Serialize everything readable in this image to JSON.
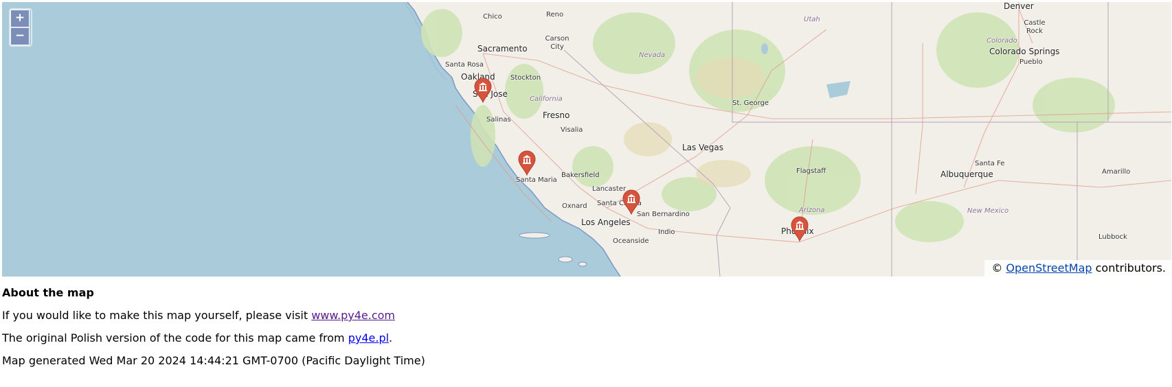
{
  "zoom": {
    "in_label": "+",
    "out_label": "−"
  },
  "attribution": {
    "prefix": "© ",
    "link": "OpenStreetMap",
    "suffix": " contributors."
  },
  "places": [
    {
      "name": "Chico",
      "kind": "city"
    },
    {
      "name": "Reno",
      "kind": "city"
    },
    {
      "name": "Carson City",
      "kind": "city"
    },
    {
      "name": "Sacramento",
      "kind": "bigcity"
    },
    {
      "name": "Santa Rosa",
      "kind": "city"
    },
    {
      "name": "Oakland",
      "kind": "bigcity"
    },
    {
      "name": "Stockton",
      "kind": "city"
    },
    {
      "name": "San Jose",
      "kind": "bigcity"
    },
    {
      "name": "California",
      "kind": "state"
    },
    {
      "name": "Nevada",
      "kind": "state"
    },
    {
      "name": "Utah",
      "kind": "state"
    },
    {
      "name": "Colorado",
      "kind": "state"
    },
    {
      "name": "Arizona",
      "kind": "state"
    },
    {
      "name": "New Mexico",
      "kind": "state"
    },
    {
      "name": "Denver",
      "kind": "bigcity"
    },
    {
      "name": "Castle Rock",
      "kind": "city"
    },
    {
      "name": "Colorado Springs",
      "kind": "bigcity"
    },
    {
      "name": "Pueblo",
      "kind": "city"
    },
    {
      "name": "Fresno",
      "kind": "bigcity"
    },
    {
      "name": "Salinas",
      "kind": "city"
    },
    {
      "name": "Visalia",
      "kind": "city"
    },
    {
      "name": "St. George",
      "kind": "city"
    },
    {
      "name": "Las Vegas",
      "kind": "bigcity"
    },
    {
      "name": "Flagstaff",
      "kind": "city"
    },
    {
      "name": "Santa Fe",
      "kind": "city"
    },
    {
      "name": "Albuquerque",
      "kind": "bigcity"
    },
    {
      "name": "Amarillo",
      "kind": "city"
    },
    {
      "name": "Bakersfield",
      "kind": "city"
    },
    {
      "name": "Santa Maria",
      "kind": "city"
    },
    {
      "name": "Lancaster",
      "kind": "city"
    },
    {
      "name": "Santa Clarita",
      "kind": "city"
    },
    {
      "name": "Oxnard",
      "kind": "city"
    },
    {
      "name": "Los Angeles",
      "kind": "bigcity"
    },
    {
      "name": "San Bernardino",
      "kind": "city"
    },
    {
      "name": "Indio",
      "kind": "city"
    },
    {
      "name": "Oceanside",
      "kind": "city"
    },
    {
      "name": "Phoenix",
      "kind": "bigcity"
    },
    {
      "name": "Lubbock",
      "kind": "city"
    }
  ],
  "markers": [
    {
      "icon": "museum-icon",
      "near": "San Jose"
    },
    {
      "icon": "museum-icon",
      "near": "Santa Maria"
    },
    {
      "icon": "museum-icon",
      "near": "Santa Clarita"
    },
    {
      "icon": "museum-icon",
      "near": "Phoenix"
    }
  ],
  "marker_color": "#d6533d",
  "about": {
    "heading": "About the map",
    "line1_prefix": "If you would like to make this map yourself, please visit ",
    "line1_link": "www.py4e.com",
    "line2_prefix": "The original Polish version of the code for this map came from ",
    "line2_link": "py4e.pl",
    "line2_suffix": ".",
    "generated": "Map generated Wed Mar 20 2024 14:44:21 GMT-0700 (Pacific Daylight Time)"
  }
}
